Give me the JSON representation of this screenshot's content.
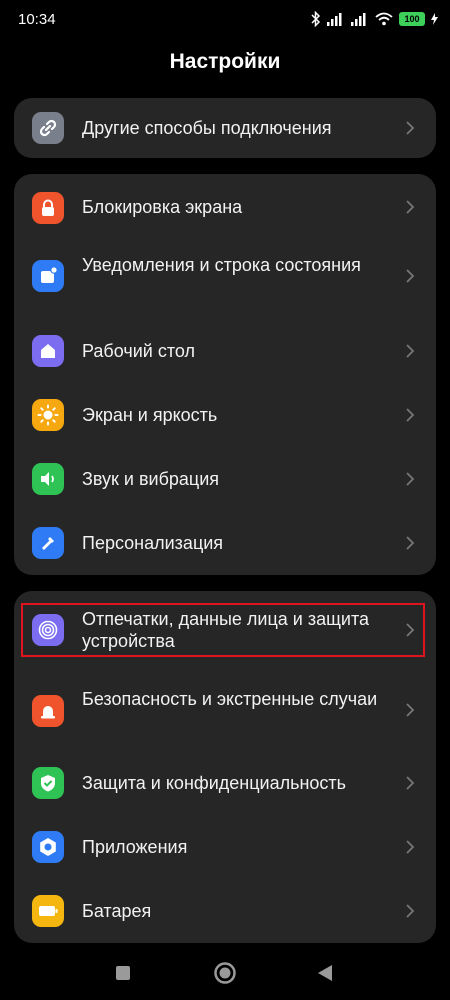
{
  "status_bar": {
    "time": "10:34",
    "battery": "100"
  },
  "header": {
    "title": "Настройки"
  },
  "cards": [
    {
      "items": [
        {
          "label": "Другие способы подключения",
          "icon": "link-icon",
          "color": "#7a7f8c"
        }
      ]
    },
    {
      "items": [
        {
          "label": "Блокировка экрана",
          "icon": "lock-icon",
          "color": "#f0542d"
        },
        {
          "label": "Уведомления и строка состояния",
          "icon": "notification-icon",
          "color": "#2f7bf5"
        },
        {
          "label": "Рабочий стол",
          "icon": "home-icon",
          "color": "#7b6cf0"
        },
        {
          "label": "Экран и яркость",
          "icon": "sun-icon",
          "color": "#f5a80f"
        },
        {
          "label": "Звук и вибрация",
          "icon": "speaker-icon",
          "color": "#2fc254"
        },
        {
          "label": "Персонализация",
          "icon": "brush-icon",
          "color": "#2f7bf5"
        }
      ]
    },
    {
      "items": [
        {
          "label": "Отпечатки, данные лица и защита устройства",
          "icon": "fingerprint-icon",
          "color": "#7b6cf0"
        },
        {
          "label": "Безопасность и экстренные случаи",
          "icon": "siren-icon",
          "color": "#f0542d"
        },
        {
          "label": "Защита и конфиденциальность",
          "icon": "shield-icon",
          "color": "#2fc254"
        },
        {
          "label": "Приложения",
          "icon": "gear-icon",
          "color": "#2f7bf5"
        },
        {
          "label": "Батарея",
          "icon": "battery-icon",
          "color": "#f5b70f"
        }
      ]
    }
  ],
  "navigation": {
    "recents": "square-icon",
    "home": "circle-icon",
    "back": "triangle-back-icon"
  }
}
